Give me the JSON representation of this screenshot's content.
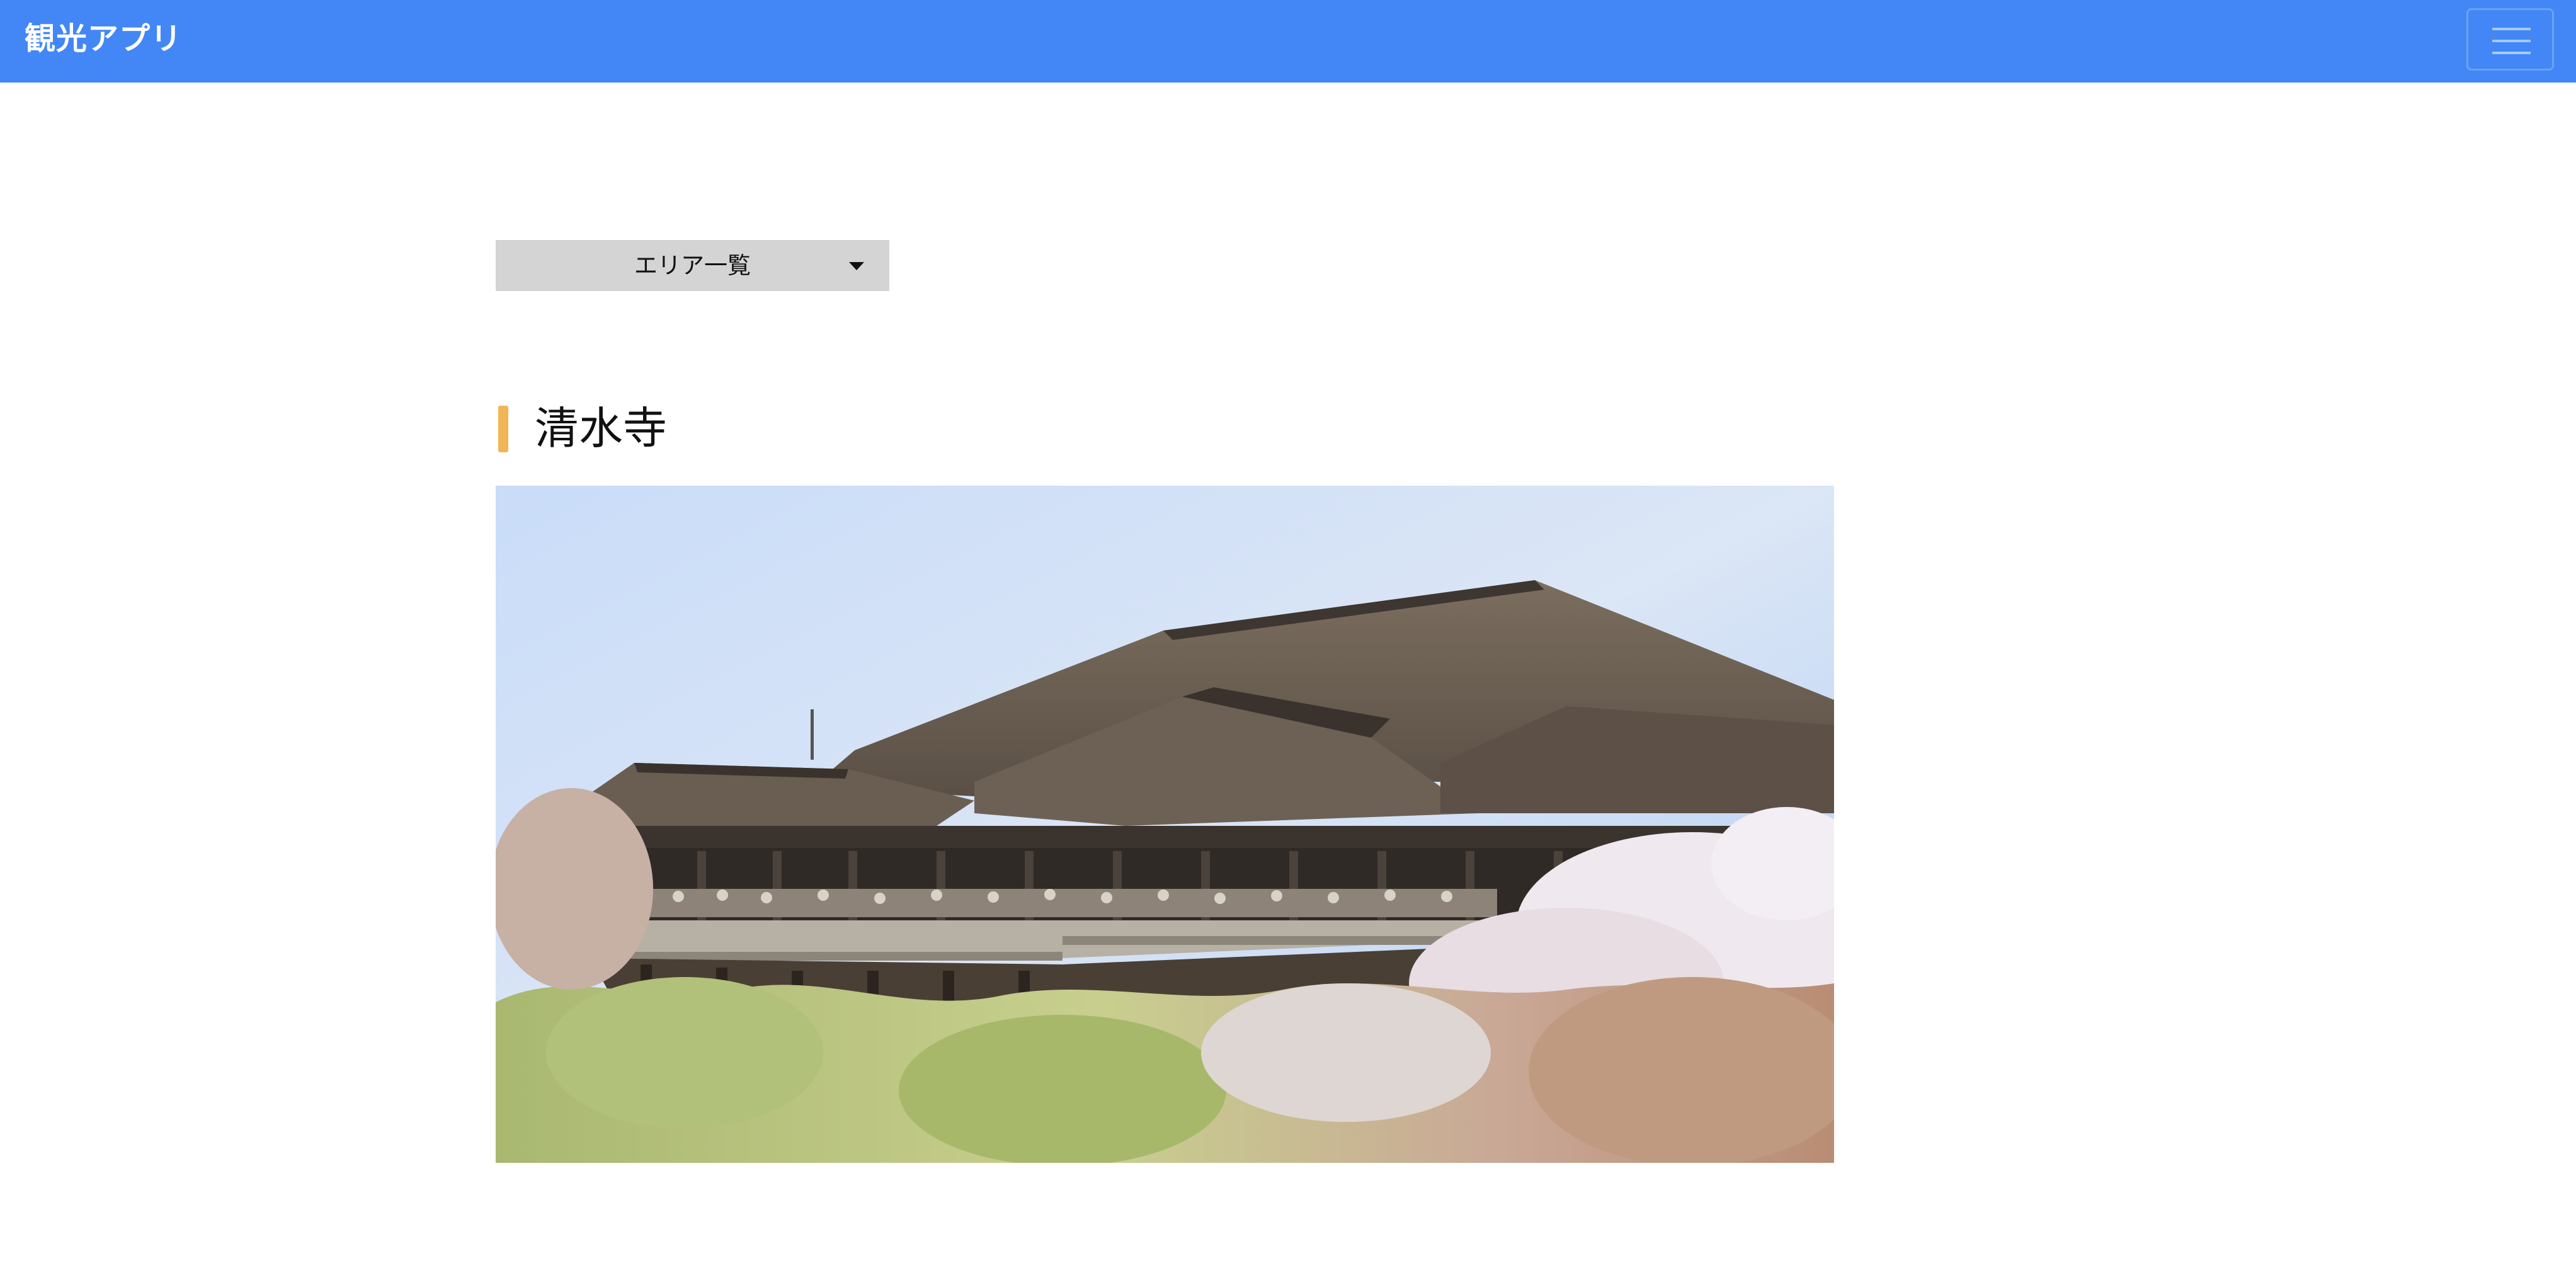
{
  "navbar": {
    "brand": "観光アプリ",
    "menu_icon": "hamburger-menu-icon",
    "background_color": "#4287f5"
  },
  "area_select": {
    "label": "エリア一覧",
    "icon": "caret-down-icon"
  },
  "spot": {
    "title": "清水寺",
    "accent_color": "#f2b555",
    "photo_icon": "temple-photo"
  }
}
